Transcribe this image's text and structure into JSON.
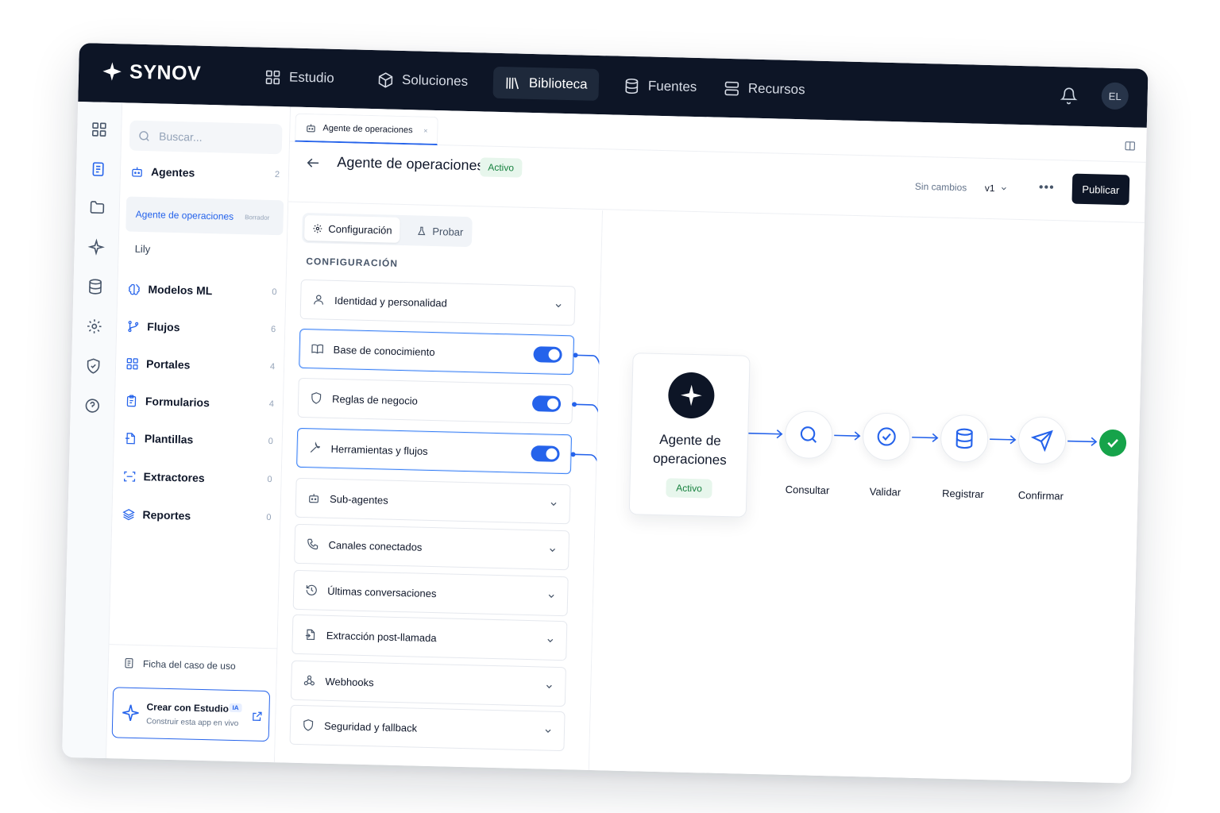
{
  "brand": {
    "name": "SYNOV"
  },
  "topnav": {
    "items": [
      {
        "label": "Estudio",
        "icon": "grid-icon"
      },
      {
        "label": "Soluciones",
        "icon": "cube-icon"
      },
      {
        "label": "Biblioteca",
        "icon": "library-icon",
        "active": true
      },
      {
        "label": "Fuentes",
        "icon": "database-icon"
      },
      {
        "label": "Recursos",
        "icon": "server-icon"
      }
    ],
    "avatar_initials": "EL"
  },
  "search": {
    "placeholder": "Buscar..."
  },
  "library": {
    "categories": [
      {
        "label": "Agentes",
        "count": "2"
      },
      {
        "label": "Modelos ML",
        "count": "0"
      },
      {
        "label": "Flujos",
        "count": "6"
      },
      {
        "label": "Portales",
        "count": "4"
      },
      {
        "label": "Formularios",
        "count": "4"
      },
      {
        "label": "Plantillas",
        "count": "0"
      },
      {
        "label": "Extractores",
        "count": "0"
      },
      {
        "label": "Reportes",
        "count": "0"
      }
    ],
    "agents": [
      {
        "label": "Agente de operaciones",
        "badge": "Borrador",
        "selected": true
      },
      {
        "label": "Lily"
      }
    ],
    "footer": {
      "ficha_label": "Ficha del caso de uso",
      "crear_title": "Crear con Estudio",
      "crear_badge": "IA",
      "crear_subtitle": "Construir esta app en vivo"
    }
  },
  "tab": {
    "label": "Agente de operaciones",
    "close": "×"
  },
  "header": {
    "title": "Agente de operaciones",
    "status": "Activo",
    "save_state": "Sin cambios",
    "version": "v1",
    "more": "•••",
    "publish_label": "Publicar"
  },
  "config": {
    "tabs": [
      {
        "label": "Configuración",
        "active": true
      },
      {
        "label": "Probar"
      }
    ],
    "section_label": "CONFIGURACIÓN",
    "rows": [
      {
        "label": "Identidad y personalidad",
        "kind": "chevron"
      },
      {
        "label": "Base de conocimiento",
        "kind": "toggle",
        "on": true
      },
      {
        "label": "Reglas de negocio",
        "kind": "toggle",
        "on": true
      },
      {
        "label": "Herramientas y flujos",
        "kind": "toggle",
        "on": true
      },
      {
        "label": "Sub-agentes",
        "kind": "chevron"
      },
      {
        "label": "Canales conectados",
        "kind": "chevron"
      },
      {
        "label": "Últimas conversaciones",
        "kind": "chevron"
      },
      {
        "label": "Extracción post-llamada",
        "kind": "chevron"
      },
      {
        "label": "Webhooks",
        "kind": "chevron"
      },
      {
        "label": "Seguridad y fallback",
        "kind": "chevron"
      }
    ]
  },
  "flow": {
    "agent_name_line1": "Agente de",
    "agent_name_line2": "operaciones",
    "agent_status": "Activo",
    "steps": [
      {
        "label": "Consultar",
        "icon": "search-icon"
      },
      {
        "label": "Validar",
        "icon": "check-circle-icon"
      },
      {
        "label": "Registrar",
        "icon": "database-icon"
      },
      {
        "label": "Confirmar",
        "icon": "send-icon"
      }
    ]
  },
  "colors": {
    "nav_bg": "#0d1526",
    "accent": "#2563eb",
    "success": "#16a34a",
    "success_bg": "#e7f6ec"
  }
}
